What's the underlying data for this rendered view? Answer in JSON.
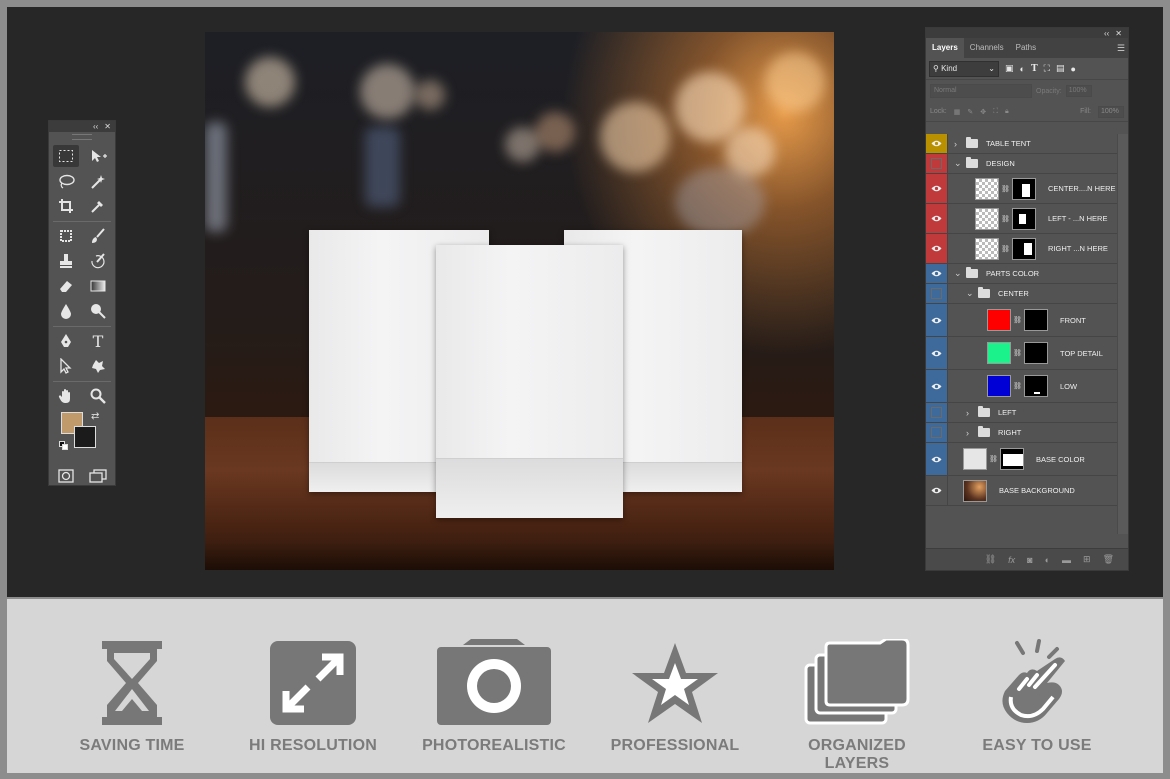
{
  "tools_panel": {
    "header_collapse": "‹‹",
    "header_close": "✕",
    "foreground_color": "#c19a6b",
    "background_color": "#1b1b1b"
  },
  "layers_panel": {
    "header_collapse": "‹‹",
    "header_close": "✕",
    "tabs": [
      "Layers",
      "Channels",
      "Paths"
    ],
    "active_tab": "Layers",
    "filter_kind": "Kind",
    "blend_mode": "Normal",
    "opacity_label": "Opacity:",
    "opacity_value": "100%",
    "lock_label": "Lock:",
    "fill_label": "Fill:",
    "fill_value": "100%",
    "layers": [
      {
        "name": "TABLE TENT",
        "type": "group",
        "indent": 0,
        "visible": true,
        "tag_color": "#b89000"
      },
      {
        "name": "DESIGN",
        "type": "group",
        "indent": 0,
        "visible": false,
        "tag_color": "#c0393b",
        "expanded": true
      },
      {
        "name": "CENTER....N HERE",
        "type": "smart",
        "indent": 1,
        "visible": true,
        "tag_color": "#c0393b"
      },
      {
        "name": "LEFT - ...N HERE",
        "type": "smart",
        "indent": 1,
        "visible": true,
        "tag_color": "#c0393b"
      },
      {
        "name": "RIGHT ...N HERE",
        "type": "smart",
        "indent": 1,
        "visible": true,
        "tag_color": "#c0393b"
      },
      {
        "name": "PARTS COLOR",
        "type": "group",
        "indent": 0,
        "visible": true,
        "tag_color": "#3d6a9a",
        "expanded": true
      },
      {
        "name": "CENTER",
        "type": "group",
        "indent": 1,
        "visible": false,
        "tag_color": "#3d6a9a",
        "expanded": true
      },
      {
        "name": "FRONT",
        "type": "color",
        "indent": 2,
        "visible": true,
        "tag_color": "#3d6a9a",
        "swatch": "#ff0000"
      },
      {
        "name": "TOP DETAIL",
        "type": "color",
        "indent": 2,
        "visible": true,
        "tag_color": "#3d6a9a",
        "swatch": "#1cf28c"
      },
      {
        "name": "LOW",
        "type": "color",
        "indent": 2,
        "visible": true,
        "tag_color": "#3d6a9a",
        "swatch": "#0000d6"
      },
      {
        "name": "LEFT",
        "type": "group",
        "indent": 1,
        "visible": false,
        "tag_color": "#3d6a9a"
      },
      {
        "name": "RIGHT",
        "type": "group",
        "indent": 1,
        "visible": false,
        "tag_color": "#3d6a9a"
      },
      {
        "name": "BASE COLOR",
        "type": "color",
        "indent": 0,
        "visible": true,
        "tag_color": "#3d6a9a",
        "swatch": "#e6e6e6"
      },
      {
        "name": "BASE BACKGROUND",
        "type": "image",
        "indent": 0,
        "visible": true,
        "tag_color": "#535353"
      }
    ]
  },
  "features": [
    {
      "label": "SAVING TIME",
      "icon": "hourglass-icon"
    },
    {
      "label": "HI RESOLUTION",
      "icon": "expand-icon"
    },
    {
      "label": "PHOTOREALISTIC",
      "icon": "camera-icon"
    },
    {
      "label": "PROFESSIONAL",
      "icon": "star-icon"
    },
    {
      "label": "ORGANIZED LAYERS",
      "icon": "folders-icon"
    },
    {
      "label": "EASY TO USE",
      "icon": "pointer-hand-icon"
    }
  ]
}
